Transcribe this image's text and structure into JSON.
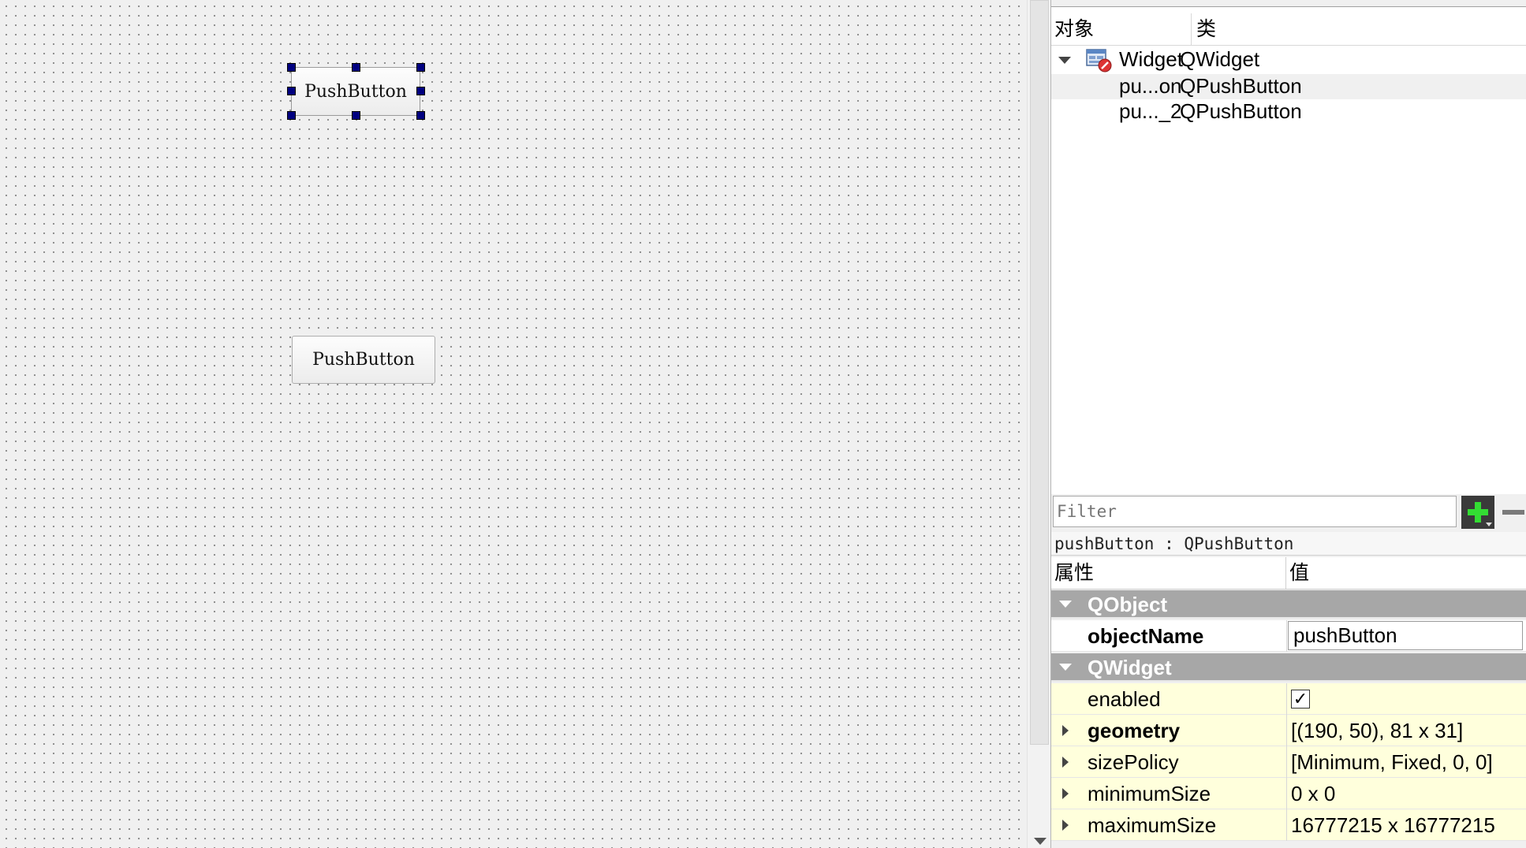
{
  "canvas": {
    "button_selected": {
      "label": "PushButton"
    },
    "button_other": {
      "label": "PushButton"
    }
  },
  "object_inspector": {
    "headers": {
      "object": "对象",
      "class": "类"
    },
    "rows": [
      {
        "name": "Widget",
        "class": "QWidget"
      },
      {
        "name": "pu...on",
        "class": "QPushButton"
      },
      {
        "name": "pu..._2",
        "class": "QPushButton"
      }
    ],
    "icon": "widget-form-icon"
  },
  "property_editor": {
    "filter_placeholder": "Filter",
    "class_label": "pushButton : QPushButton",
    "headers": {
      "property": "属性",
      "value": "值"
    },
    "groups": [
      {
        "label": "QObject"
      },
      {
        "label": "QWidget"
      }
    ],
    "object_name": {
      "label": "objectName",
      "value": "pushButton"
    },
    "enabled": {
      "label": "enabled",
      "value": "✓"
    },
    "rows": [
      {
        "label": "geometry",
        "value": "[(190, 50), 81 x 31]"
      },
      {
        "label": "sizePolicy",
        "value": "[Minimum, Fixed, 0, 0]"
      },
      {
        "label": "minimumSize",
        "value": "0 x 0"
      },
      {
        "label": "maximumSize",
        "value": "16777215 x 16777215"
      }
    ],
    "colors": {
      "group_bg": "#a7a7a7",
      "row_yellow": "#ffffdc",
      "add_green": "#33dd33",
      "selection_handle": "#000080"
    }
  }
}
